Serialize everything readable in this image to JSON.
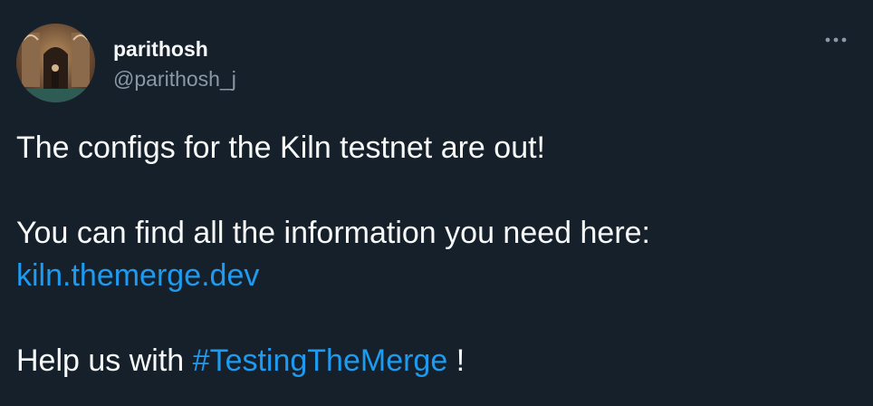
{
  "author": {
    "display_name": "parithosh",
    "handle": "@parithosh_j",
    "avatar_icon": "avatar-photo"
  },
  "menu": {
    "icon": "more-icon"
  },
  "tweet": {
    "line1": "The configs for the Kiln testnet are out!",
    "line2": "You can find all the information you need here:",
    "link": "kiln.themerge.dev",
    "line3_prefix": "Help us with",
    "hashtag": "#TestingTheMerge",
    "line3_suffix": "!"
  },
  "colors": {
    "background": "#15202b",
    "text_primary": "#f7f9f9",
    "text_secondary": "#8b98a5",
    "link": "#1d9bf0"
  }
}
